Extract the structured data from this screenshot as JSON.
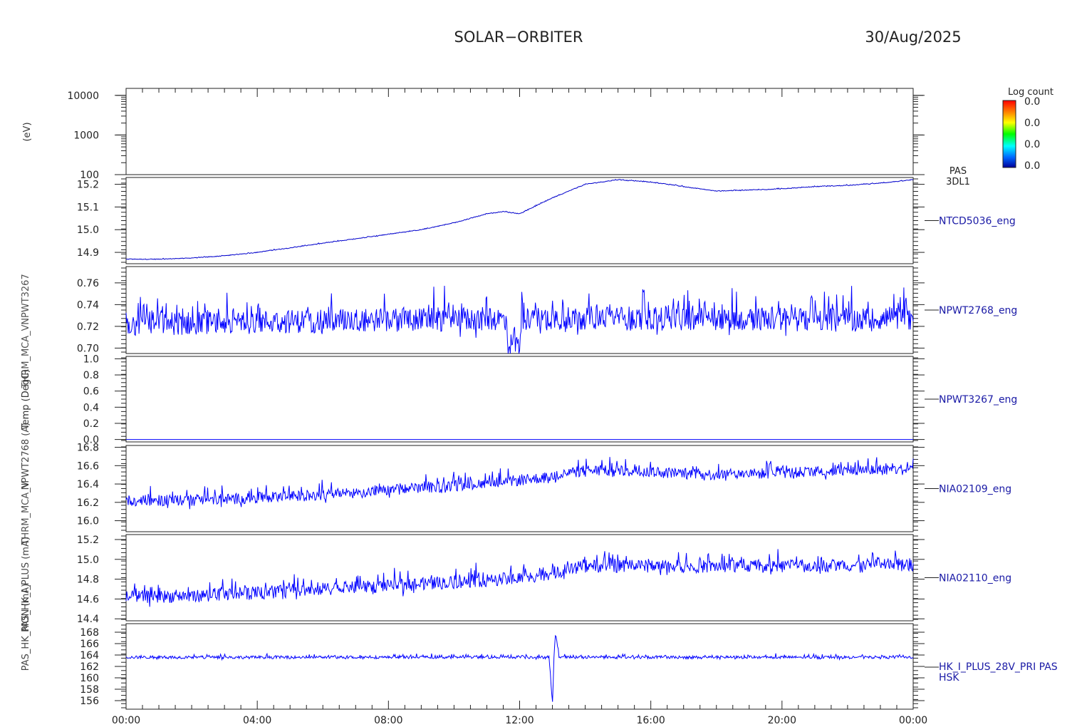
{
  "header": {
    "mission": "SOLAR−ORBITER",
    "date": "30/Aug/2025"
  },
  "x_axis": {
    "tick_labels": [
      "00:00",
      "04:00",
      "08:00",
      "12:00",
      "16:00",
      "20:00",
      "00:00"
    ],
    "tick_hours": [
      0,
      4,
      8,
      12,
      16,
      20,
      24
    ],
    "range_hours": [
      0,
      24
    ]
  },
  "colorbar": {
    "title": "Log count",
    "labels": [
      "0.0",
      "0.0",
      "0.0",
      "0.0"
    ],
    "colors": [
      "#ff0000",
      "#ff8800",
      "#ffff00",
      "#00ff00",
      "#00ffff",
      "#0066ff",
      "#000099"
    ]
  },
  "side_ylabels": [
    "Temp (DegC)",
    "NPWT2768 (A)",
    "NPWT3267",
    "THRM_MCA_V",
    "THRM_MCA_V",
    "PAS_HK_I_PLUS (mA)",
    "PAS_HK_MON (mA)"
  ],
  "chart_data": [
    {
      "type": "spectrogram",
      "ylabel": "(eV)",
      "yscale": "log",
      "ylim": [
        100,
        15000
      ],
      "ytick_labels": [
        "10000",
        "1000",
        "100"
      ],
      "ytick_values": [
        10000,
        1000,
        100
      ],
      "right_label": [
        "PAS",
        "3DL1"
      ],
      "values": []
    },
    {
      "type": "line",
      "right_label": "NTCD5036_eng",
      "ylim": [
        14.85,
        15.23
      ],
      "ytick_labels": [
        "15.2",
        "15.1",
        "15.0",
        "14.9"
      ],
      "ytick_values": [
        15.2,
        15.1,
        15.0,
        14.9
      ],
      "color": "#0000cc",
      "noise": 0.003,
      "x_hours": [
        0,
        1,
        2,
        3,
        4,
        5,
        6,
        7,
        8,
        9,
        10,
        11,
        11.5,
        12,
        13,
        14,
        15,
        16,
        17,
        18,
        19,
        20,
        21,
        22,
        23,
        24
      ],
      "y": [
        14.87,
        14.87,
        14.875,
        14.885,
        14.9,
        14.92,
        14.94,
        14.96,
        14.98,
        15.0,
        15.03,
        15.07,
        15.08,
        15.07,
        15.14,
        15.2,
        15.22,
        15.21,
        15.19,
        15.17,
        15.175,
        15.18,
        15.19,
        15.195,
        15.205,
        15.22
      ]
    },
    {
      "type": "line",
      "right_label": "NPWT2768_eng",
      "ylim": [
        0.695,
        0.775
      ],
      "ytick_labels": [
        "0.76",
        "0.74",
        "0.72",
        "0.70"
      ],
      "ytick_values": [
        0.76,
        0.74,
        0.72,
        0.7
      ],
      "color": "#0000ff",
      "noise": 0.022,
      "x_hours": [
        0,
        4,
        8,
        11.6,
        11.65,
        12.0,
        12.05,
        14,
        18,
        22,
        24
      ],
      "y": [
        0.722,
        0.724,
        0.726,
        0.727,
        0.703,
        0.703,
        0.727,
        0.728,
        0.727,
        0.726,
        0.727
      ]
    },
    {
      "type": "line",
      "right_label": "NPWT3267_eng",
      "ylim": [
        -0.03,
        1.03
      ],
      "ytick_labels": [
        "1.0",
        "0.8",
        "0.6",
        "0.4",
        "0.2",
        "0.0"
      ],
      "ytick_values": [
        1.0,
        0.8,
        0.6,
        0.4,
        0.2,
        0.0
      ],
      "color": "#0000ff",
      "noise": 0.0,
      "x_hours": [
        0,
        24
      ],
      "y": [
        0.0,
        0.0
      ]
    },
    {
      "type": "line",
      "right_label": "NIA02109_eng",
      "ylim": [
        15.88,
        16.82
      ],
      "ytick_labels": [
        "16.8",
        "16.6",
        "16.4",
        "16.2",
        "16.0"
      ],
      "ytick_values": [
        16.8,
        16.6,
        16.4,
        16.2,
        16.0
      ],
      "color": "#0000ff",
      "noise": 0.12,
      "x_hours": [
        0,
        2,
        4,
        6,
        8,
        10,
        12,
        13,
        14,
        16,
        18,
        20,
        22,
        24
      ],
      "y": [
        16.22,
        16.22,
        16.25,
        16.28,
        16.33,
        16.38,
        16.44,
        16.48,
        16.55,
        16.53,
        16.5,
        16.52,
        16.55,
        16.56
      ]
    },
    {
      "type": "line",
      "right_label": "NIA02110_eng",
      "ylim": [
        14.38,
        15.25
      ],
      "ytick_labels": [
        "15.2",
        "15.0",
        "14.8",
        "14.6",
        "14.4"
      ],
      "ytick_values": [
        15.2,
        15.0,
        14.8,
        14.6,
        14.4
      ],
      "color": "#0000ff",
      "noise": 0.13,
      "x_hours": [
        0,
        2,
        4,
        6,
        8,
        10,
        12,
        13,
        14,
        16,
        18,
        20,
        22,
        24
      ],
      "y": [
        14.62,
        14.63,
        14.66,
        14.7,
        14.73,
        14.77,
        14.81,
        14.86,
        14.93,
        14.93,
        14.93,
        14.93,
        14.94,
        14.94
      ]
    },
    {
      "type": "line",
      "right_label": [
        "HK_I_PLUS_28V_PRI PAS",
        "HSK"
      ],
      "ylim": [
        154.5,
        169.5
      ],
      "ytick_labels": [
        "168",
        "166",
        "164",
        "162",
        "160",
        "158",
        "156"
      ],
      "ytick_values": [
        168,
        166,
        164,
        162,
        160,
        158,
        156
      ],
      "color": "#0000ff",
      "noise": 0.5,
      "x_hours": [
        0,
        12.9,
        13.0,
        13.05,
        13.1,
        13.2,
        24
      ],
      "y": [
        163.6,
        163.6,
        155.0,
        164.0,
        168.0,
        163.6,
        163.6
      ]
    }
  ]
}
